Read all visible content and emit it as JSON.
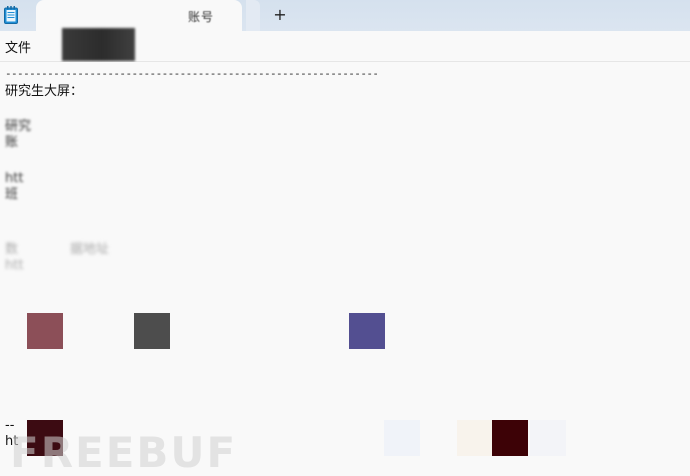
{
  "window": {
    "tab_title": "账号",
    "new_tab_symbol": "+"
  },
  "menu": {
    "file_label": "文件"
  },
  "document": {
    "separator": "----------------------------------------------------------------",
    "heading": "研究生大屏：",
    "lines_group1": [
      "研究",
      "账"
    ],
    "lines_group2": [
      "htt",
      "班"
    ],
    "lines_group3": [
      "数　　　　据地址",
      "htt"
    ],
    "bottom_line1": "--",
    "bottom_line2": "ht"
  },
  "watermark": "FREEBUF",
  "colors": {
    "tab_strip": "#d5e1ee",
    "background": "#f9f9f9",
    "swatch_1": "#8c4f58",
    "swatch_2": "#4d4d4d",
    "swatch_3": "#534f91",
    "swatch_4": "#3c0b12",
    "swatch_7": "#3d0206"
  },
  "icons": {
    "app": "notepad-icon"
  }
}
